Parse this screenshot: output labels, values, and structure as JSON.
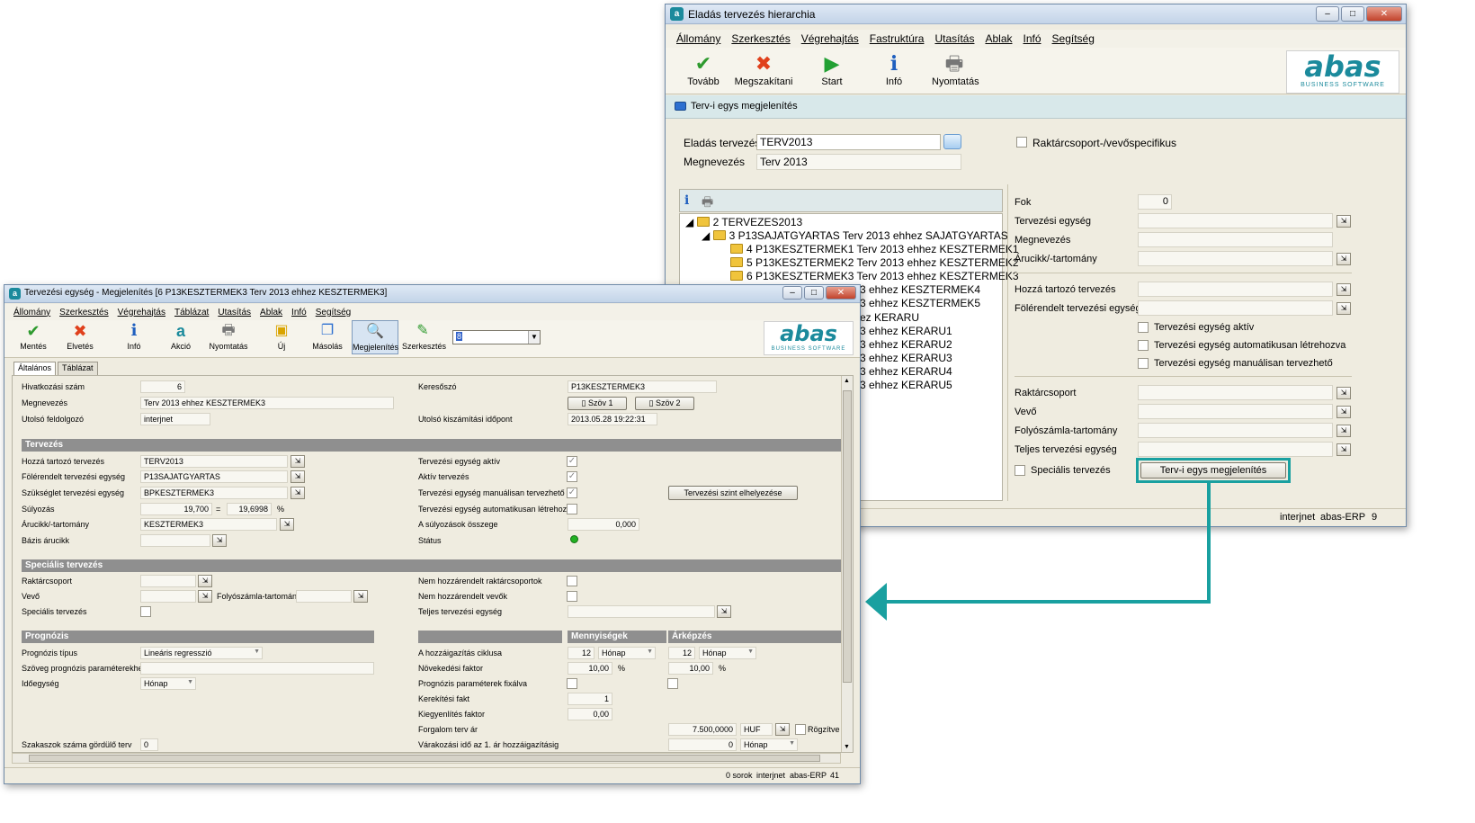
{
  "big_window": {
    "title": "Eladás tervezés hierarchia",
    "menu": [
      "Állomány",
      "Szerkesztés",
      "Végrehajtás",
      "Fastruktúra",
      "Utasítás",
      "Ablak",
      "Infó",
      "Segítség"
    ],
    "toolbar": {
      "tovabb": "Tovább",
      "megszakitani": "Megszakítani",
      "start": "Start",
      "info": "Infó",
      "nyomtatas": "Nyomtatás"
    },
    "logo": {
      "text": "abas",
      "sub": "BUSINESS SOFTWARE"
    },
    "subheader": "Terv-i egys megjelenítés",
    "fields": {
      "eladas_label": "Eladás tervezés",
      "eladas_value": "TERV2013",
      "megnevezes_label": "Megnevezés",
      "megnevezes_value": "Terv 2013",
      "raktar_check_label": "Raktárcsoport-/vevőspecifikus"
    },
    "tree": [
      "2 TERVEZES2013",
      "3 P13SAJATGYARTAS Terv 2013 ehhez SAJATGYARTAS",
      "4 P13KESZTERMEK1 Terv 2013 ehhez KESZTERMEK1",
      "5 P13KESZTERMEK2 Terv 2013 ehhez KESZTERMEK2",
      "6 P13KESZTERMEK3 Terv 2013 ehhez KESZTERMEK3",
      "3 ehhez KESZTERMEK4",
      "3 ehhez KESZTERMEK5",
      "ez KERARU",
      "3 ehhez KERARU1",
      "3 ehhez KERARU2",
      "3 ehhez KERARU3",
      "3 ehhez KERARU4",
      "3 ehhez KERARU5"
    ],
    "right": {
      "fok_label": "Fok",
      "fok_value": "0",
      "tervezesi_egyseg": "Tervezési egység",
      "megnevezes": "Megnevezés",
      "arucikk": "Árucikk/-tartomány",
      "hozza_tartozo": "Hozzá tartozó tervezés",
      "folerendelt": "Fölérendelt tervezési egység",
      "cb1": "Tervezési egység aktív",
      "cb2": "Tervezési egység automatikusan létrehozva",
      "cb3": "Tervezési egység manuálisan tervezhető",
      "raktarcsoport": "Raktárcsoport",
      "vevo": "Vevő",
      "folyoszamla": "Folyószámla-tartomány",
      "teljes": "Teljes tervezési egység",
      "specialis": "Speciális tervezés",
      "button": "Terv-i egys megjelenítés"
    },
    "status": {
      "user": "interjnet",
      "app": "abas-ERP",
      "num": "9"
    }
  },
  "small_window": {
    "title": "Tervezési egység - Megjelenítés  [6   P13KESZTERMEK3   Terv 2013 ehhez KESZTERMEK3]",
    "menu": [
      "Állomány",
      "Szerkesztés",
      "Végrehajtás",
      "Táblázat",
      "Utasítás",
      "Ablak",
      "Infó",
      "Segítség"
    ],
    "toolbar": {
      "mentes": "Mentés",
      "elvetes": "Elvetés",
      "info": "Infó",
      "akcio": "Akció",
      "nyomtatas": "Nyomtatás",
      "uj": "Új",
      "masolas": "Másolás",
      "megjelenites": "Megjelenítés",
      "szerkesztes": "Szerkesztés",
      "combo": "8"
    },
    "tabs": [
      "Általános",
      "Táblázat"
    ],
    "general": {
      "hivatkozasi_label": "Hivatkozási szám",
      "hivatkozasi_value": "6",
      "megnevezes_label": "Megnevezés",
      "megnevezes_value": "Terv 2013 ehhez KESZTERMEK3",
      "utolso_label": "Utolsó feldolgozó",
      "utolso_value": "interjnet",
      "keresoszo_label": "Keresőszó",
      "keresoszo_value": "P13KESZTERMEK3",
      "szov1": "Szöv 1",
      "szov2": "Szöv 2",
      "kiszamitasi_label": "Utolsó kiszámítási időpont",
      "kiszamitasi_value": "2013.05.28 19:22:31"
    },
    "sections": {
      "tervezes": "Tervezés",
      "specialis": "Speciális tervezés",
      "prognozis": "Prognózis",
      "mennyisegek": "Mennyiségek",
      "arkepzes": "Árképzés"
    },
    "tervezes": {
      "hozza_label": "Hozzá tartozó tervezés",
      "hozza_value": "TERV2013",
      "folerendelt_label": "Fölérendelt tervezési egység",
      "folerendelt_value": "P13SAJATGYARTAS",
      "szukseglet_label": "Szükséglet tervezési egység",
      "szukseglet_value": "BPKESZTERMEK3",
      "sulyozas_label": "Súlyozás",
      "sulyozas_value": "19,700",
      "eq": "=",
      "sulyozas_pct": "19,6998",
      "pct": "%",
      "arucikk_label": "Árucikk/-tartomány",
      "arucikk_value": "KESZTERMEK3",
      "bazis_label": "Bázis árucikk",
      "aktiv_label": "Tervezési egység aktív",
      "aktiv_terv_label": "Aktív tervezés",
      "manualis_label": "Tervezési egység manuálisan tervezhető",
      "auto_label": "Tervezési egység automatikusan létrehozva",
      "osszeg_label": "A súlyozások összege",
      "osszeg_value": "0,000",
      "status_label": "Státus",
      "szint_button": "Tervezési szint elhelyezése"
    },
    "specialis": {
      "raktar_label": "Raktárcsoport",
      "vevo_label": "Vevő",
      "folyo_label": "Folyószámla-tartomány",
      "spec_label": "Speciális tervezés",
      "nem_raktar_label": "Nem hozzárendelt raktárcsoportok",
      "nem_vevo_label": "Nem hozzárendelt vevők",
      "teljes_label": "Teljes tervezési egység"
    },
    "prognozis": {
      "tipus_label": "Prognózis típus",
      "tipus_value": "Lineáris regresszió",
      "szoveg_label": "Szöveg prognózis paraméterekhez",
      "idoegyseg_label": "Időegység",
      "idoegyseg_value": "Hónap",
      "szakaszok_label": "Szakaszok száma gördülő terv",
      "szakaszok_value": "0",
      "ciklus_label": "A hozzáigazítás ciklusa",
      "ciklus_m": "12",
      "ciklus_m_unit": "Hónap",
      "ciklus_a": "12",
      "ciklus_a_unit": "Hónap",
      "novekedesi_label": "Növekedési faktor",
      "novekedesi_m": "10,00",
      "novekedesi_a": "10,00",
      "pct": "%",
      "fixalva_label": "Prognózis paraméterek fixálva",
      "kerekitesi_label": "Kerekítési fakt",
      "kerekitesi_value": "1",
      "kiegyenlites_label": "Kiegyenlítés faktor",
      "kiegyenlites_value": "0,00",
      "forgalom_label": "Forgalom terv ár",
      "forgalom_value": "7.500,0000",
      "currency": "HUF",
      "rogzitve": "Rögzítve",
      "varakozasi_label": "Várakozási idő az 1. ár hozzáigazításig",
      "varakozasi_value": "0",
      "varakozasi_unit": "Hónap"
    },
    "status": {
      "rows": "0 sorok",
      "user": "interjnet",
      "app": "abas-ERP",
      "num": "41"
    }
  },
  "colors": {
    "accent": "#1b8a9c",
    "highlight": "#19a0a0"
  }
}
